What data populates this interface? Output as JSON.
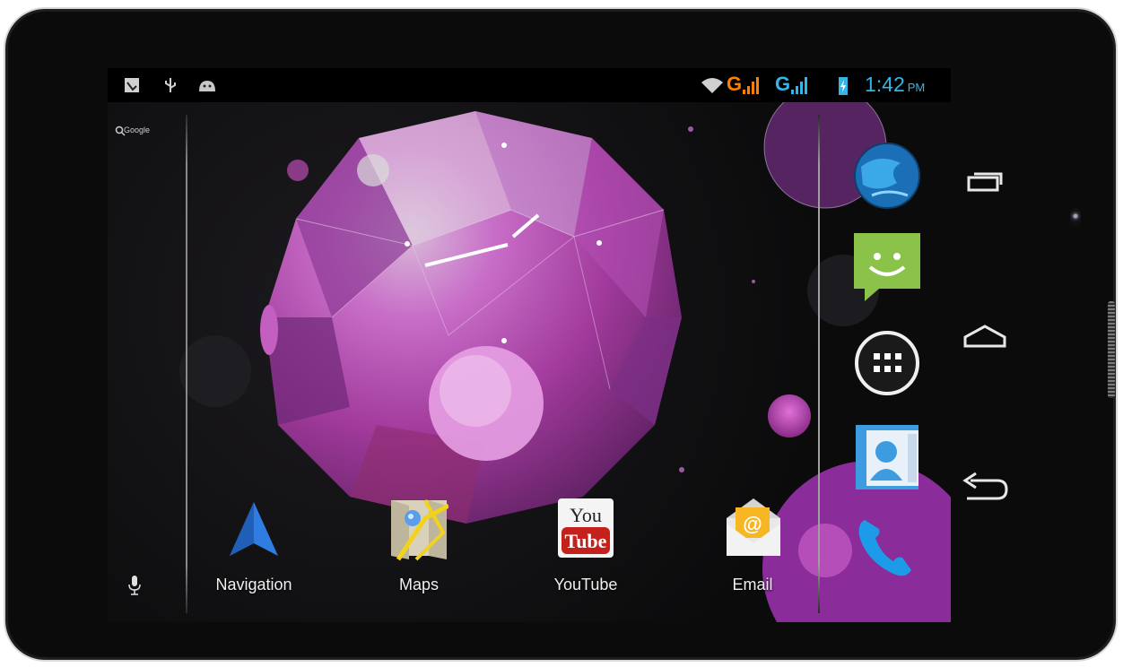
{
  "status_bar": {
    "left_icons": [
      "screenshot-icon",
      "usb-icon",
      "android-debug-icon"
    ],
    "network_1": "G",
    "network_2": "G",
    "time": "1:42",
    "ampm": "PM",
    "colors": {
      "wifi": "#d0d0d0",
      "network_1": "#ff7f00",
      "network_2": "#33b5e5",
      "clock": "#33b5e5"
    }
  },
  "search": {
    "label": "Google",
    "icons": [
      "search-icon",
      "microphone-icon"
    ]
  },
  "home_apps": [
    {
      "label": "Navigation",
      "icon": "navigation-icon"
    },
    {
      "label": "Maps",
      "icon": "maps-icon"
    },
    {
      "label": "YouTube",
      "icon": "youtube-icon",
      "icon_text_top": "You",
      "icon_text_bottom": "Tube"
    },
    {
      "label": "Email",
      "icon": "email-icon",
      "icon_text": "@"
    }
  ],
  "dock": [
    "browser-globe-icon",
    "messaging-icon",
    "all-apps-icon",
    "contacts-icon",
    "phone-icon"
  ],
  "nav_buttons": [
    "recent-apps-icon",
    "home-icon",
    "back-icon"
  ],
  "wallpaper": {
    "description_colors": [
      "#a13a9c",
      "#d45fcb",
      "#7a3fa0",
      "#5a2a6a"
    ]
  }
}
